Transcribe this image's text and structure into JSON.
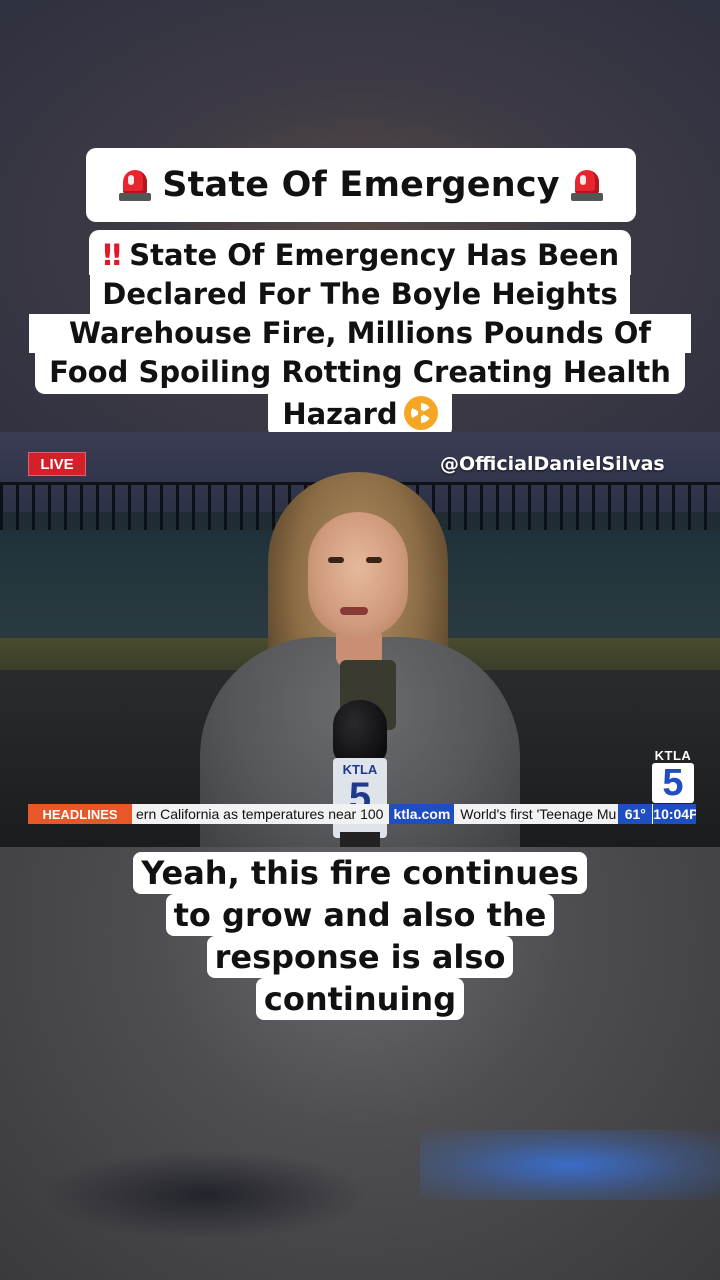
{
  "title_card": {
    "text": "State Of Emergency",
    "left_icon": "police-siren-icon",
    "right_icon": "police-siren-icon"
  },
  "headline": {
    "prefix_icon": "double-exclamation-icon",
    "lines": [
      "State Of Emergency Has Been",
      "Declared For The Boyle Heights",
      "Warehouse Fire, Millions Pounds Of",
      "Food Spoiling Rotting Creating Health",
      "Hazard"
    ],
    "suffix_icon": "radioactive-icon"
  },
  "video": {
    "live_badge": "LIVE",
    "watermark_handle": "@OfficialDanielSilvas",
    "station_logo": {
      "text": "KTLA",
      "number": "5"
    },
    "mic_flag": {
      "text": "KTLA",
      "number": "5"
    },
    "ticker": {
      "label": "HEADLINES",
      "text": "ern California as temperatures near 100",
      "site": "ktla.com",
      "text2": "World's first 'Teenage Mu",
      "temperature": "61°",
      "time": "10:04P"
    }
  },
  "caption": {
    "lines": [
      "Yeah, this fire continues",
      "to grow and also the",
      "response is also",
      "continuing"
    ]
  },
  "colors": {
    "live_red": "#d3202a",
    "ticker_orange": "#e8562a",
    "ktla_blue": "#1f4ec0",
    "siren_red": "#e8242e",
    "radioactive_orange": "#f5a623"
  }
}
